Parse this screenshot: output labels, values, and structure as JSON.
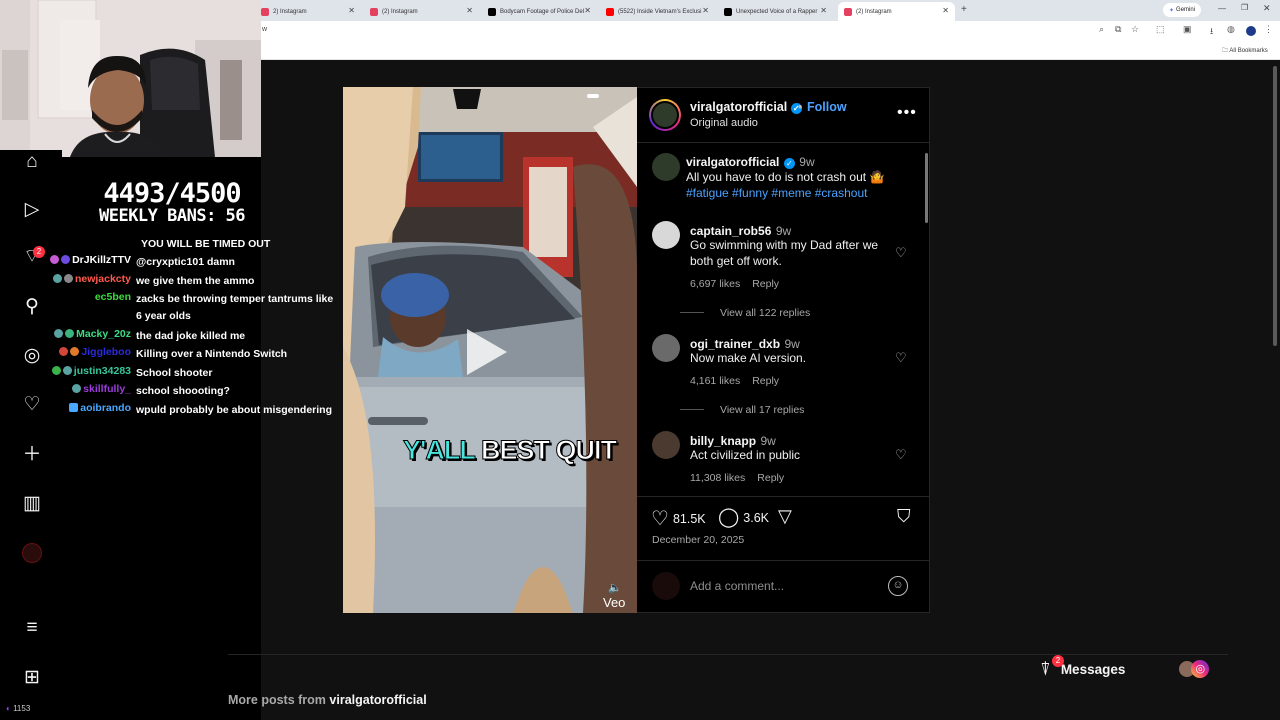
{
  "browser": {
    "tabs": [
      {
        "title": "2) Instagram",
        "color": "#e4405f"
      },
      {
        "title": "(2) Instagram",
        "color": "#e4405f"
      },
      {
        "title": "Bodycam Footage of Police Del",
        "color": "#000000"
      },
      {
        "title": "(5522) Inside Vietnam's Exclusi",
        "color": "#ff0000"
      },
      {
        "title": "Unexpected Voice of a Rapper",
        "color": "#000000"
      },
      {
        "title": "(2) Instagram",
        "color": "#e4405f"
      }
    ],
    "new_tab": "+",
    "gemini": "Gemini",
    "address_fragment": "w",
    "all_bookmarks": "All Bookmarks"
  },
  "overlay": {
    "counter": "4493/4500",
    "weekly_bans": "WEEKLY BANS: 56",
    "timeout_line": "YOU WILL BE TIMED OUT",
    "chat": [
      {
        "nick": "DrJKillzTTV",
        "color": "#ffffff",
        "msg": "@cryxptic101 damn"
      },
      {
        "nick": "newjackcty",
        "color": "#ff5b4f",
        "msg": "we give them the ammo"
      },
      {
        "nick": "ec5ben",
        "color": "#3ddc3d",
        "msg": "zacks be throwing temper tantrums like 6 year olds"
      },
      {
        "nick": "Macky_20z",
        "color": "#3ddc84",
        "msg": "the dad joke killed me"
      },
      {
        "nick": "Jiggleboo",
        "color": "#2b2bdd",
        "msg": "Killing over a Nintendo Switch"
      },
      {
        "nick": "justin34283",
        "color": "#35c89c",
        "msg": "School shooter"
      },
      {
        "nick": "skillfully_",
        "color": "#9b3bdc",
        "msg": "school shoooting?"
      },
      {
        "nick": "aoibrando",
        "color": "#4aa8ff",
        "msg": "wpuld probably be about misgendering"
      }
    ],
    "viewer_count": "1153",
    "notif_count": "2"
  },
  "sidebar": {
    "icons": [
      "home-icon",
      "reels-icon",
      "messages-icon",
      "search-icon",
      "explore-icon",
      "notifications-icon",
      "create-icon",
      "insights-icon",
      "profile-icon",
      "menu-icon",
      "apps-icon"
    ]
  },
  "post": {
    "author": "viralgatorofficial",
    "follow": "Follow",
    "separator": "•",
    "audio": "Original audio",
    "caption_user": "viralgatorofficial",
    "caption_time": "9w",
    "caption_text": "All you have to do is not crash out 🤷",
    "hashtags": "#fatigue #funny #meme #crashout",
    "video_caption_part1": "Y'ALL",
    "video_caption_part2": "BEST QUIT",
    "watermark": "Veo",
    "likes": "81.5K",
    "comments_count": "3.6K",
    "date": "December 20, 2025",
    "add_comment_placeholder": "Add a comment...",
    "comments": [
      {
        "user": "captain_rob56",
        "time": "9w",
        "text": "Go swimming with my Dad after we both get off work.",
        "likes": "6,697 likes",
        "reply": "Reply",
        "replies": "View all 122 replies"
      },
      {
        "user": "ogi_trainer_dxb",
        "time": "9w",
        "text": "Now make AI version.",
        "likes": "4,161 likes",
        "reply": "Reply",
        "replies": "View all 17 replies"
      },
      {
        "user": "billy_knapp",
        "time": "9w",
        "text": "Act civilized in public",
        "likes": "11,308 likes",
        "reply": "Reply",
        "replies": ""
      }
    ]
  },
  "footer": {
    "more_posts_prefix": "More posts from",
    "more_posts_user": "viralgatorofficial",
    "messages_label": "Messages",
    "messages_badge": "2"
  },
  "colors": {
    "ig_blue": "#0095f6",
    "link_blue": "#4ca3ff",
    "badge_red": "#ff3040"
  }
}
